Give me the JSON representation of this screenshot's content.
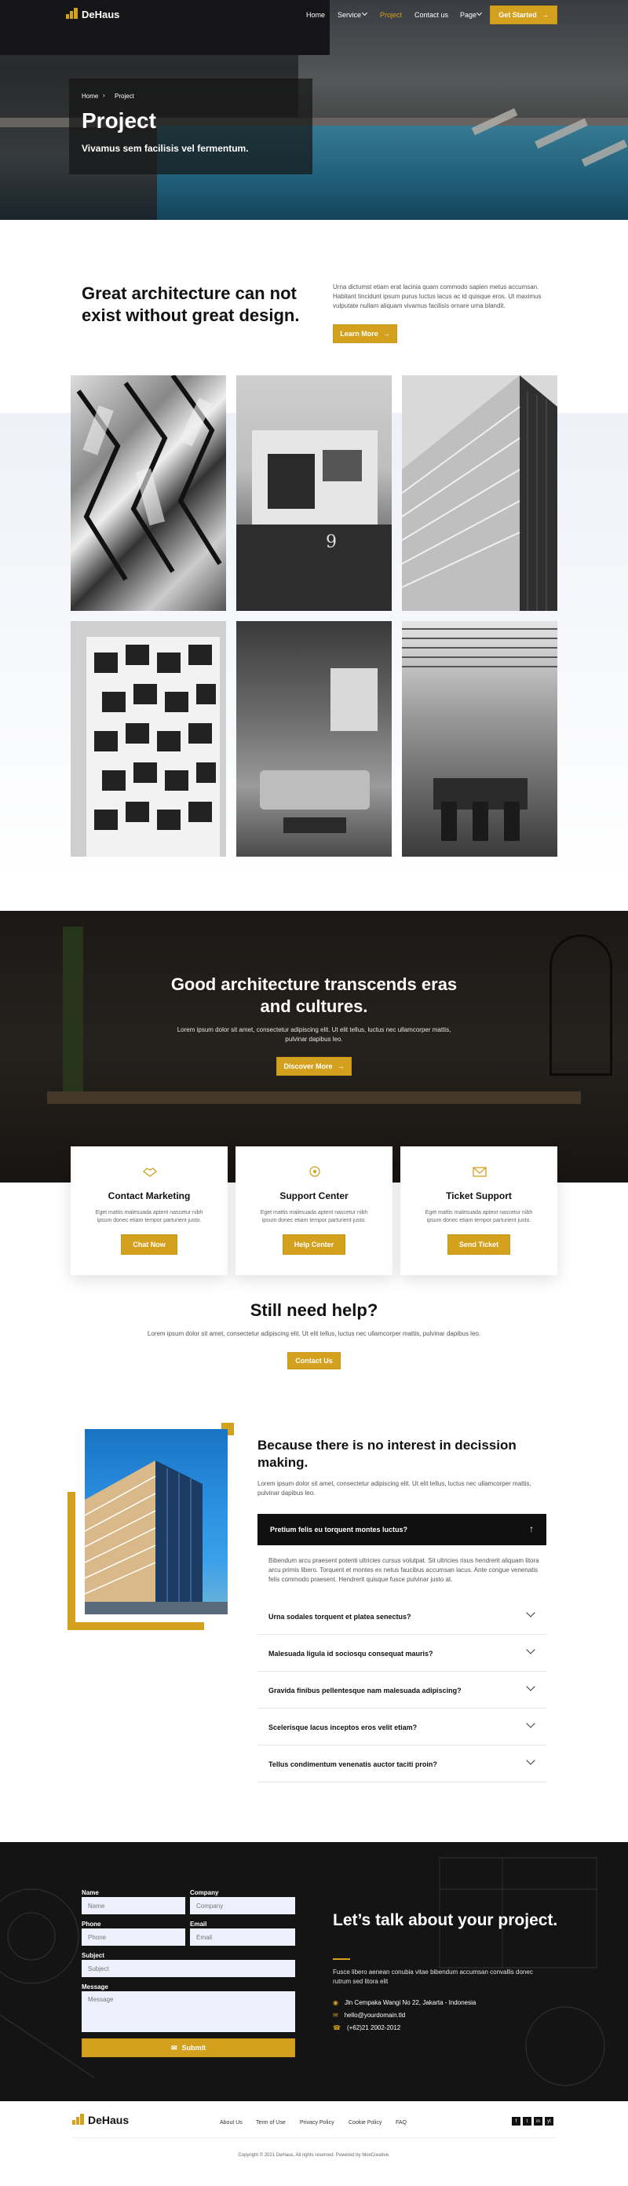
{
  "brand": {
    "name": "DeHaus",
    "accent": "#d4a11e"
  },
  "nav": {
    "items": [
      {
        "label": "Home"
      },
      {
        "label": "Service"
      },
      {
        "label": "Project"
      },
      {
        "label": "Contact us"
      },
      {
        "label": "Page"
      }
    ],
    "cta_label": "Get Started"
  },
  "hero": {
    "breadcrumb": {
      "home": "Home",
      "current": "Project"
    },
    "title": "Project",
    "subtitle": "Vivamus sem facilisis vel fermentum."
  },
  "intro": {
    "title": "Great architecture can not exist without great design.",
    "text": "Urna dictumst etiam erat lacinia quam commodo sapien metus accumsan. Habitant tincidunt ipsum purus luctus lacus ac id quisque eros. Ut maximus vulputate nullam aliquam vivamus facilisis ornare urna blandit.",
    "button": "Learn More"
  },
  "gallery": {
    "house_number": "9"
  },
  "cta": {
    "title": "Good architecture transcends eras and cultures.",
    "text": "Lorem ipsum dolor sit amet, consectetur adipiscing elit. Ut elit tellus, luctus nec ullamcorper mattis, pulvinar dapibus leo.",
    "button": "Discover More"
  },
  "cards": [
    {
      "title": "Contact Marketing",
      "text": "Eget mattis malesuada aptent nascetur nibh ipsum donec etiam tempor parturient justo.",
      "button": "Chat Now",
      "icon": "handshake-icon"
    },
    {
      "title": "Support Center",
      "text": "Eget mattis malesuada aptent nascetur nibh ipsum donec etiam tempor parturient justo.",
      "button": "Help Center",
      "icon": "support-icon"
    },
    {
      "title": "Ticket Support",
      "text": "Eget mattis malesuada aptent nascetur nibh ipsum donec etiam tempor parturient justo.",
      "button": "Send Ticket",
      "icon": "envelope-icon"
    }
  ],
  "help": {
    "title": "Still need help?",
    "text": "Lorem ipsum dolor sit amet, consectetur adipiscing elit. Ut elit tellus, luctus nec ullamcorper mattis, pulvinar dapibus leo.",
    "button": "Contact Us"
  },
  "faq": {
    "title": "Because there is no interest in decission making.",
    "subtitle": "Lorem ipsum dolor sit amet, consectetur adipiscing elit. Ut elit tellus, luctus nec ullamcorper mattis, pulvinar dapibus leo.",
    "open_question": "Pretium felis eu torquent montes luctus?",
    "open_answer": "Bibendum arcu praesent potenti ultricies cursus volutpat. Sit ultricies risus hendrerit aliquam litora arcu primis libero. Torquent et montes ex netus faucibus accumsan lacus. Ante congue venenatis felis commodo praesent. Hendrerit quisque fusce pulvinar justo at.",
    "questions": [
      "Urna sodales torquent et platea senectus?",
      "Malesuada ligula id sociosqu consequat mauris?",
      "Gravida finibus pellentesque nam malesuada adipiscing?",
      "Scelerisque lacus inceptos eros velit etiam?",
      "Tellus condimentum venenatis auctor taciti proin?"
    ]
  },
  "contact": {
    "form": {
      "name_label": "Name",
      "name_placeholder": "Name",
      "company_label": "Company",
      "company_placeholder": "Company",
      "phone_label": "Phone",
      "phone_placeholder": "Phone",
      "email_label": "Email",
      "email_placeholder": "Email",
      "subject_label": "Subject",
      "subject_placeholder": "Subject",
      "message_label": "Message",
      "message_placeholder": "Message",
      "submit": "Submit"
    },
    "title": "Let’s talk about your project.",
    "text": "Fusce libero aenean conubia vitae bibendum accumsan convallis donec rutrum sed litora elit",
    "address": "Jln Cempaka Wangi No 22, Jakarta - Indonesia",
    "email": "hello@yourdomain.tld",
    "phone": "(+62)21 2002-2012"
  },
  "footer": {
    "links": [
      "About Us",
      "Term of Use",
      "Privacy Policy",
      "Cookie Policy",
      "FAQ"
    ],
    "social": [
      "f",
      "t",
      "in",
      "yt"
    ],
    "copyright": "Copyright © 2021 DeHaus. All rights reserved. Powered by MoxCreative."
  }
}
